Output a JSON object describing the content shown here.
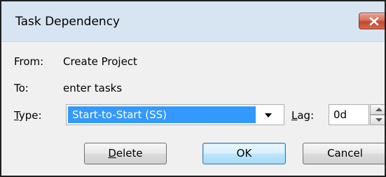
{
  "dialog": {
    "title": "Task Dependency"
  },
  "info": {
    "from_label": "From:",
    "from_value": "Create Project",
    "to_label": "To:",
    "to_value": "enter tasks"
  },
  "type_field": {
    "label": "Type:",
    "selected_value": "Start-to-Start (SS)"
  },
  "lag_field": {
    "label": "Lag:",
    "value": "0d"
  },
  "buttons": {
    "delete": "Delete",
    "ok": "OK",
    "cancel": "Cancel"
  },
  "icons": {
    "close": "close-icon",
    "dropdown": "chevron-down-icon",
    "spin_up": "spin-up-icon",
    "spin_down": "spin-down-icon"
  },
  "colors": {
    "title_bar": "#d7e4f2",
    "selection": "#3399ff",
    "close_button": "#c5452b",
    "dialog_background": "#f0f0f0"
  }
}
